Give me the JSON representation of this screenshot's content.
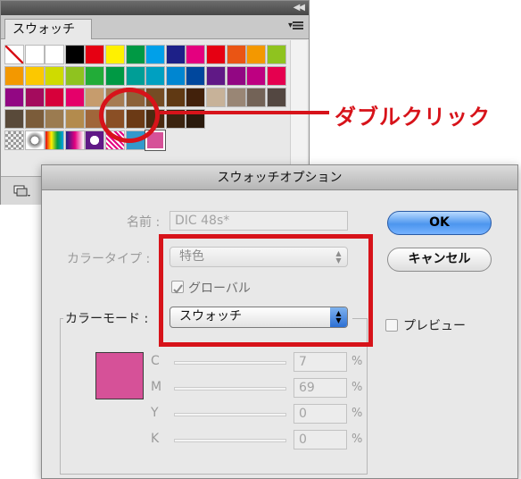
{
  "panel": {
    "tab_label": "スウォッチ",
    "swatch_rows": [
      [
        "none",
        "#ffffff",
        "#ffffff",
        "#000000",
        "#e60012",
        "#fff100",
        "#009944",
        "#00a0e9",
        "#1d2088",
        "#e4007f",
        "#e60012",
        "#ea5514",
        "#f39800",
        "#8fc31f"
      ],
      [
        "#f39800",
        "#fcc800",
        "#cfdb00",
        "#8fc31f",
        "#22ac38",
        "#009944",
        "#009e96",
        "#00a0c1",
        "#0086d1",
        "#00479d",
        "#601986",
        "#920783",
        "#be0081",
        "#e5004f"
      ],
      [
        "#920783",
        "#a40b5d",
        "#d7003a",
        "#e5006a",
        "#c69c6d",
        "#a67c52",
        "#8c6239",
        "#754c24",
        "#603913",
        "#42210b",
        "#c7b299",
        "#998675",
        "#736357",
        "#534741"
      ],
      [
        "#594a3a",
        "#7b5c3a",
        "#9b7b50",
        "#b38b4d",
        "#a0663a",
        "#8a4f25",
        "#6b3a15",
        "#4a2a10",
        "#3b2410",
        "#2a1a0d"
      ],
      [
        "pattern",
        "pattern2",
        "gradient1",
        "gradient2",
        "gradient3",
        "pattern3",
        "#3399cc",
        "#d65198"
      ]
    ]
  },
  "callout": {
    "text": "ダブルクリック"
  },
  "dialog": {
    "title": "スウォッチオプション",
    "name_label": "名前 :",
    "name_value": "DIC 48s*",
    "colortype_label": "カラータイプ :",
    "colortype_value": "特色",
    "global_label": "グローバル",
    "global_checked": true,
    "colormode_label": "カラーモード :",
    "colormode_value": "スウォッチ",
    "ok_label": "OK",
    "cancel_label": "キャンセル",
    "preview_label": "プレビュー",
    "preview_checked": false,
    "preview_color": "#d65198",
    "channels": [
      {
        "label": "C",
        "value": "7",
        "unit": "%"
      },
      {
        "label": "M",
        "value": "69",
        "unit": "%"
      },
      {
        "label": "Y",
        "value": "0",
        "unit": "%"
      },
      {
        "label": "K",
        "value": "0",
        "unit": "%"
      }
    ]
  },
  "colors": {
    "accent_red": "#d7131a",
    "ok_blue": "#4d96ee"
  }
}
